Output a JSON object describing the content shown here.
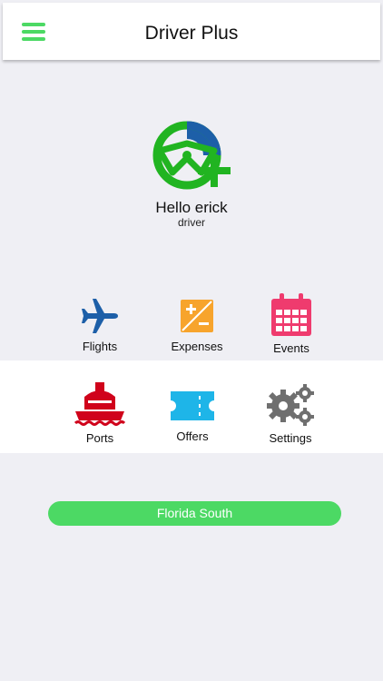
{
  "header": {
    "title": "Driver Plus"
  },
  "profile": {
    "greeting": "Hello erick",
    "role": "driver"
  },
  "menu": {
    "flights": "Flights",
    "expenses": "Expenses",
    "events": "Events",
    "ports": "Ports",
    "offers": "Offers",
    "settings": "Settings"
  },
  "region_button": "Florida South",
  "colors": {
    "accent": "#4cd964",
    "blue": "#1d5fa8",
    "orange": "#f7a42c",
    "pink": "#ef3b6e",
    "red": "#d0021b",
    "cyan": "#1eb5e8",
    "gray": "#6f6f6f"
  }
}
